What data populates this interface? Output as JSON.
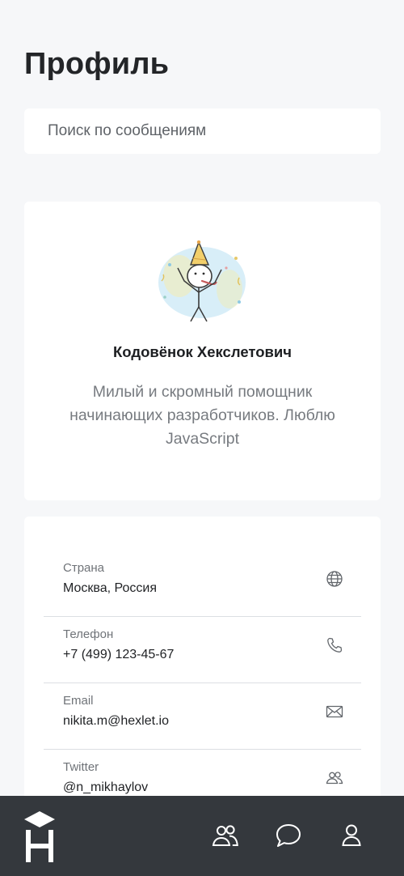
{
  "header": {
    "title": "Профиль"
  },
  "search": {
    "placeholder": "Поиск по сообщениям",
    "value": ""
  },
  "profile": {
    "name": "Кодовёнок Хекслетович",
    "bio": "Милый и скромный помощник начинающих разработчиков. Люблю JavaScript",
    "avatar_icon": "party-kid-avatar"
  },
  "info": [
    {
      "label": "Страна",
      "value": "Москва, Россия",
      "icon": "globe-icon"
    },
    {
      "label": "Телефон",
      "value": "+7 (499) 123-45-67",
      "icon": "phone-icon"
    },
    {
      "label": "Email",
      "value": "nikita.m@hexlet.io",
      "icon": "mail-icon"
    },
    {
      "label": "Twitter",
      "value": "@n_mikhaylov",
      "icon": "users-icon"
    }
  ],
  "bottom_nav": {
    "logo": "hexlet-logo",
    "items": [
      {
        "name": "contacts",
        "icon": "users-icon"
      },
      {
        "name": "chats",
        "icon": "chat-icon"
      },
      {
        "name": "profile",
        "icon": "user-icon"
      }
    ]
  },
  "colors": {
    "background": "#f6f7f9",
    "card": "#ffffff",
    "nav_bar": "#34383d",
    "title": "#232528",
    "muted_text": "#777b80",
    "divider": "#dcdfe3"
  }
}
